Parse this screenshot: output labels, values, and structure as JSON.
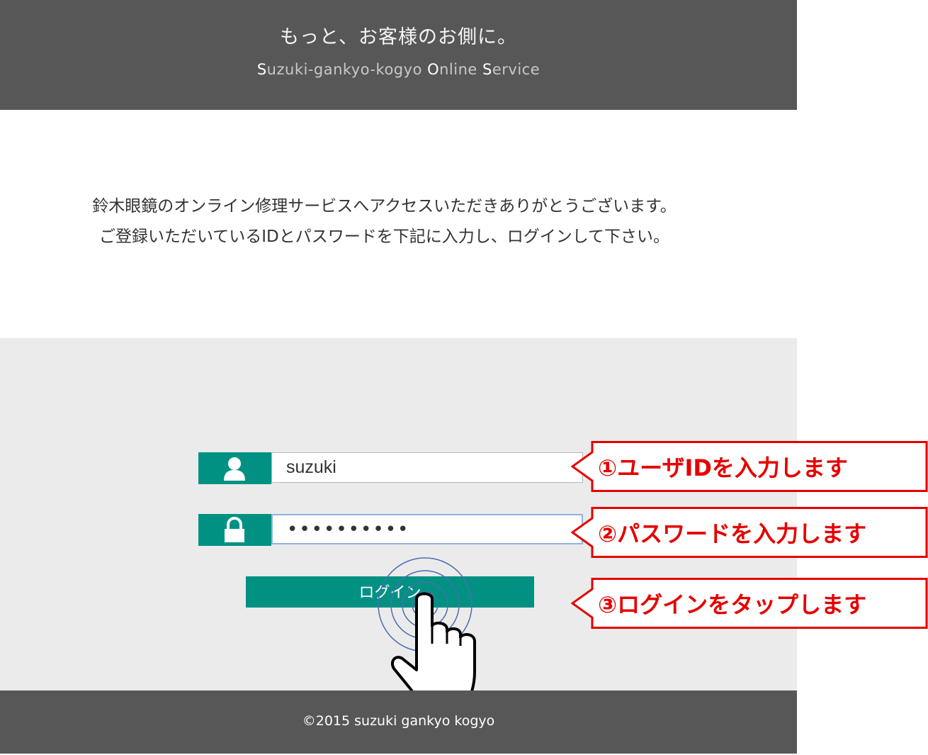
{
  "header": {
    "tagline": "もっと、お客様のお側に。",
    "service": {
      "s1": "S",
      "t1": "uzuki-gankyo-kogyo ",
      "s2": "O",
      "t2": "nline ",
      "s3": "S",
      "t3": "ervice"
    }
  },
  "intro": {
    "line1": "鈴木眼鏡のオンライン修理サービスへアクセスいただきありがとうございます。",
    "line2": "ご登録いただいているIDとパスワードを下記に入力し、ログインして下さい。"
  },
  "login": {
    "user_value": "suzuki",
    "password_value": "••••••••••",
    "button_label": "ログイン"
  },
  "callouts": {
    "step1": "①ユーザIDを入力します",
    "step2": "②パスワードを入力します",
    "step3": "③ログインをタップします"
  },
  "footer": {
    "copyright": "©2015 suzuki gankyo kogyo"
  },
  "colors": {
    "header_bg": "#575757",
    "accent": "#009183",
    "panel_bg": "#ebebeb",
    "callout_red": "#e60000"
  },
  "icons": [
    "user-icon",
    "lock-icon",
    "tap-hand-icon"
  ]
}
